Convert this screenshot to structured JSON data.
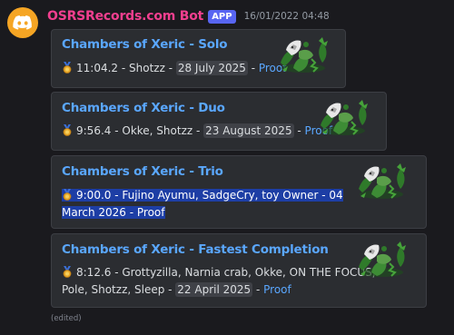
{
  "message": {
    "author": "OSRSRecords.com Bot",
    "badge": "APP",
    "timestamp": "16/01/2022 04:48",
    "edited_label": "(edited)"
  },
  "embeds": [
    {
      "title": "Chambers of Xeric - Solo",
      "time": "11:04.2",
      "players": "Shotzz",
      "date": "28 July 2025",
      "link": "Proof"
    },
    {
      "title": "Chambers of Xeric - Duo",
      "time": "9:56.4",
      "players": "Okke, Shotzz",
      "date": "23 August 2025",
      "link": "Proof"
    },
    {
      "title": "Chambers of Xeric - Trio",
      "line1": "9:00.0 - Fujino Ayumu, SadgeCry, toy Owner - 04",
      "line2": "March 2026 - Proof"
    },
    {
      "title": "Chambers of Xeric - Fastest Completion",
      "line1": "8:12.6 - Grottyzilla, Narnia crab, Okke, ON THE FOCUS,",
      "line2_prefix": "Pole, Shotzz, Sleep - ",
      "date": "22 April 2025",
      "link": "Proof"
    }
  ],
  "icons": {
    "avatar": "discord-logo-icon",
    "medal": "gold-medal-icon",
    "thumbnail": "olm-boss-icon"
  },
  "colors": {
    "background": "#1a1a1e",
    "embed_bg": "#2b2d31",
    "author": "#f23f8f",
    "badge": "#5865f2",
    "link": "#5aa7ff",
    "selection": "#1d3ea5",
    "avatar": "#f5a524"
  }
}
